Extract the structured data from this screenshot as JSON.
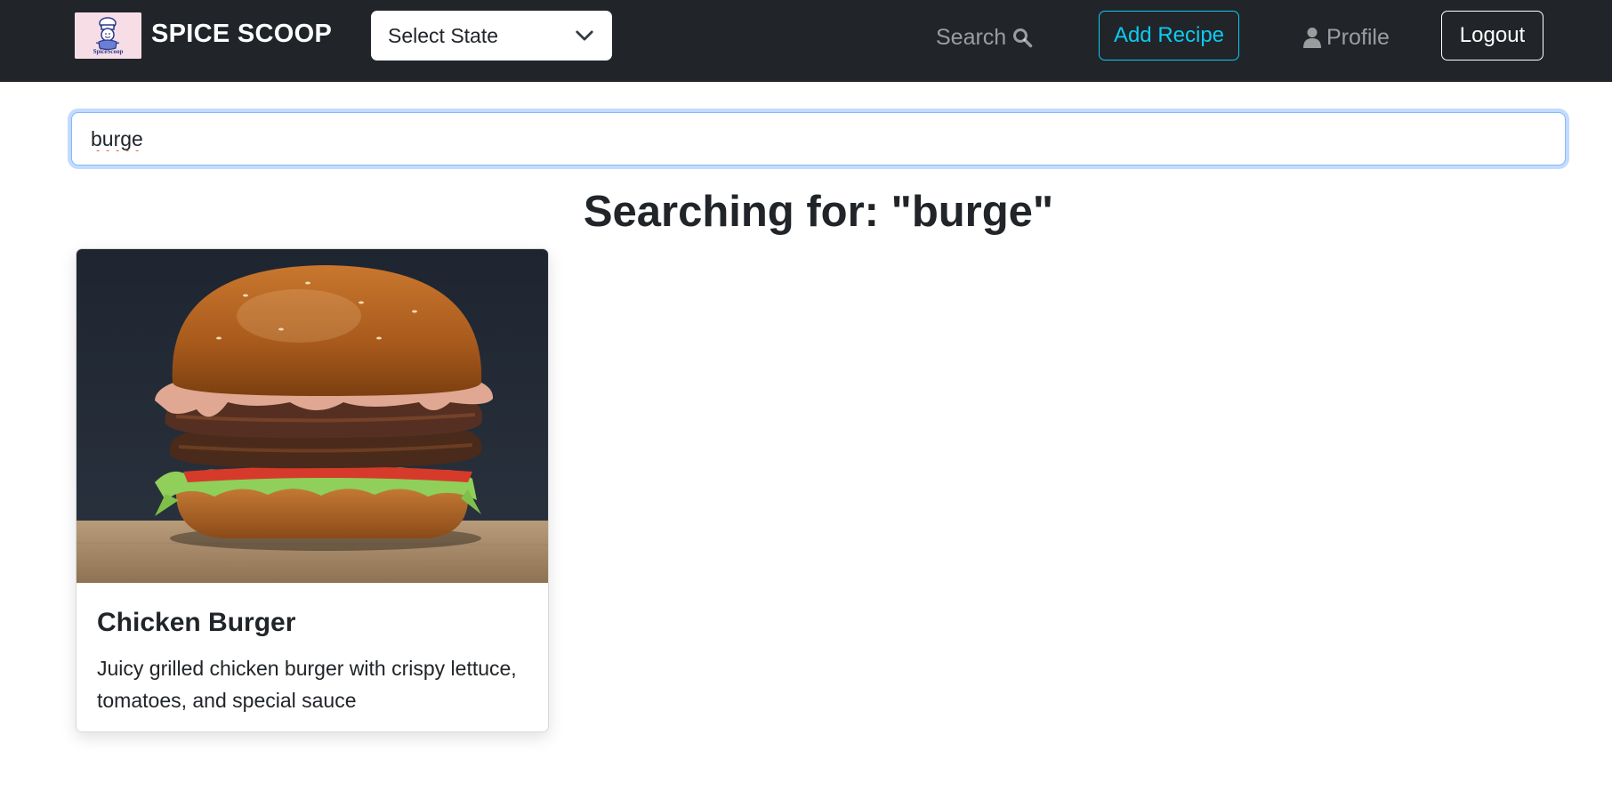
{
  "navbar": {
    "brand_name": "SPICE SCOOP",
    "logo_text": "SpiceScoop",
    "state_select": {
      "value": "Select State"
    },
    "search_link": "Search",
    "add_recipe_button": "Add Recipe",
    "profile_link": "Profile",
    "logout_button": "Logout"
  },
  "search": {
    "value": "burge"
  },
  "results": {
    "heading": "Searching for: \"burge\""
  },
  "recipes": [
    {
      "title": "Chicken Burger",
      "description": "Juicy grilled chicken burger with crispy lettuce, tomatoes, and special sauce"
    }
  ],
  "colors": {
    "navbar_bg": "#212529",
    "accent_info": "#0dcaf0",
    "focus_ring": "#86b7fe",
    "logo_bg": "#f7dde6"
  },
  "icons": {
    "search": "search-icon",
    "profile": "user-icon",
    "select_chevron": "chevron-down-icon"
  }
}
